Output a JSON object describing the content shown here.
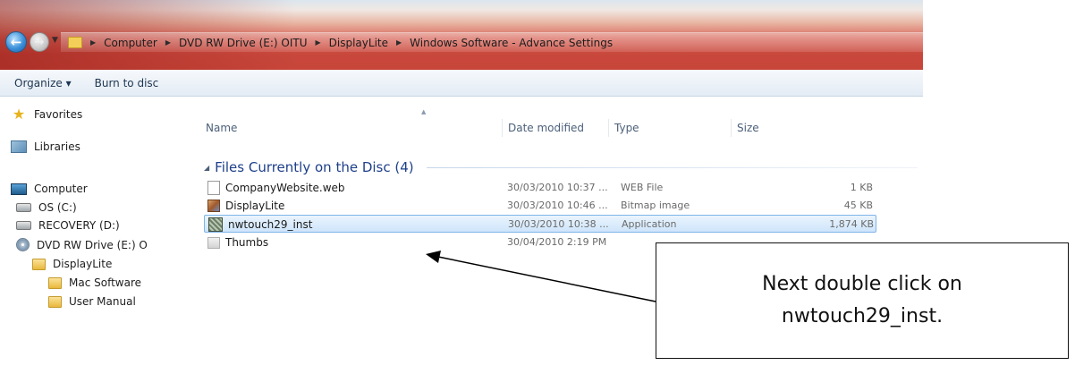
{
  "breadcrumbs": [
    "Computer",
    "DVD RW Drive (E:) OITU",
    "DisplayLite",
    "Windows Software - Advance Settings"
  ],
  "toolbar": {
    "organize_label": "Organize ▾",
    "burn_label": "Burn to disc"
  },
  "nav": {
    "favorites": "Favorites",
    "libraries": "Libraries",
    "computer": "Computer",
    "os_drive": "OS (C:)",
    "recovery_drive": "RECOVERY (D:)",
    "dvd_drive": "DVD RW Drive (E:) O",
    "folder_displaylite": "DisplayLite",
    "folder_mac": "Mac Software",
    "folder_manual": "User Manual"
  },
  "columns": {
    "name": "Name",
    "date": "Date modified",
    "type": "Type",
    "size": "Size"
  },
  "group_label": "Files Currently on the Disc (4)",
  "files": [
    {
      "name": "CompanyWebsite.web",
      "date": "30/03/2010 10:37 ...",
      "type": "WEB File",
      "size": "1 KB",
      "icon": "web-file-icon"
    },
    {
      "name": "DisplayLite",
      "date": "30/03/2010 10:46 ...",
      "type": "Bitmap image",
      "size": "45 KB",
      "icon": "bitmap-icon"
    },
    {
      "name": "nwtouch29_inst",
      "date": "30/03/2010 10:38 ...",
      "type": "Application",
      "size": "1,874 KB",
      "icon": "application-icon"
    },
    {
      "name": "Thumbs",
      "date": "30/04/2010 2:19 PM",
      "type": "",
      "size": "",
      "icon": "thumbs-icon"
    }
  ],
  "callout_text": "Next double click on nwtouch29_inst.",
  "colors": {
    "title_gradient_main": "#c8473c",
    "selection": "#cfe5fb",
    "group_label": "#1e3f8a"
  }
}
